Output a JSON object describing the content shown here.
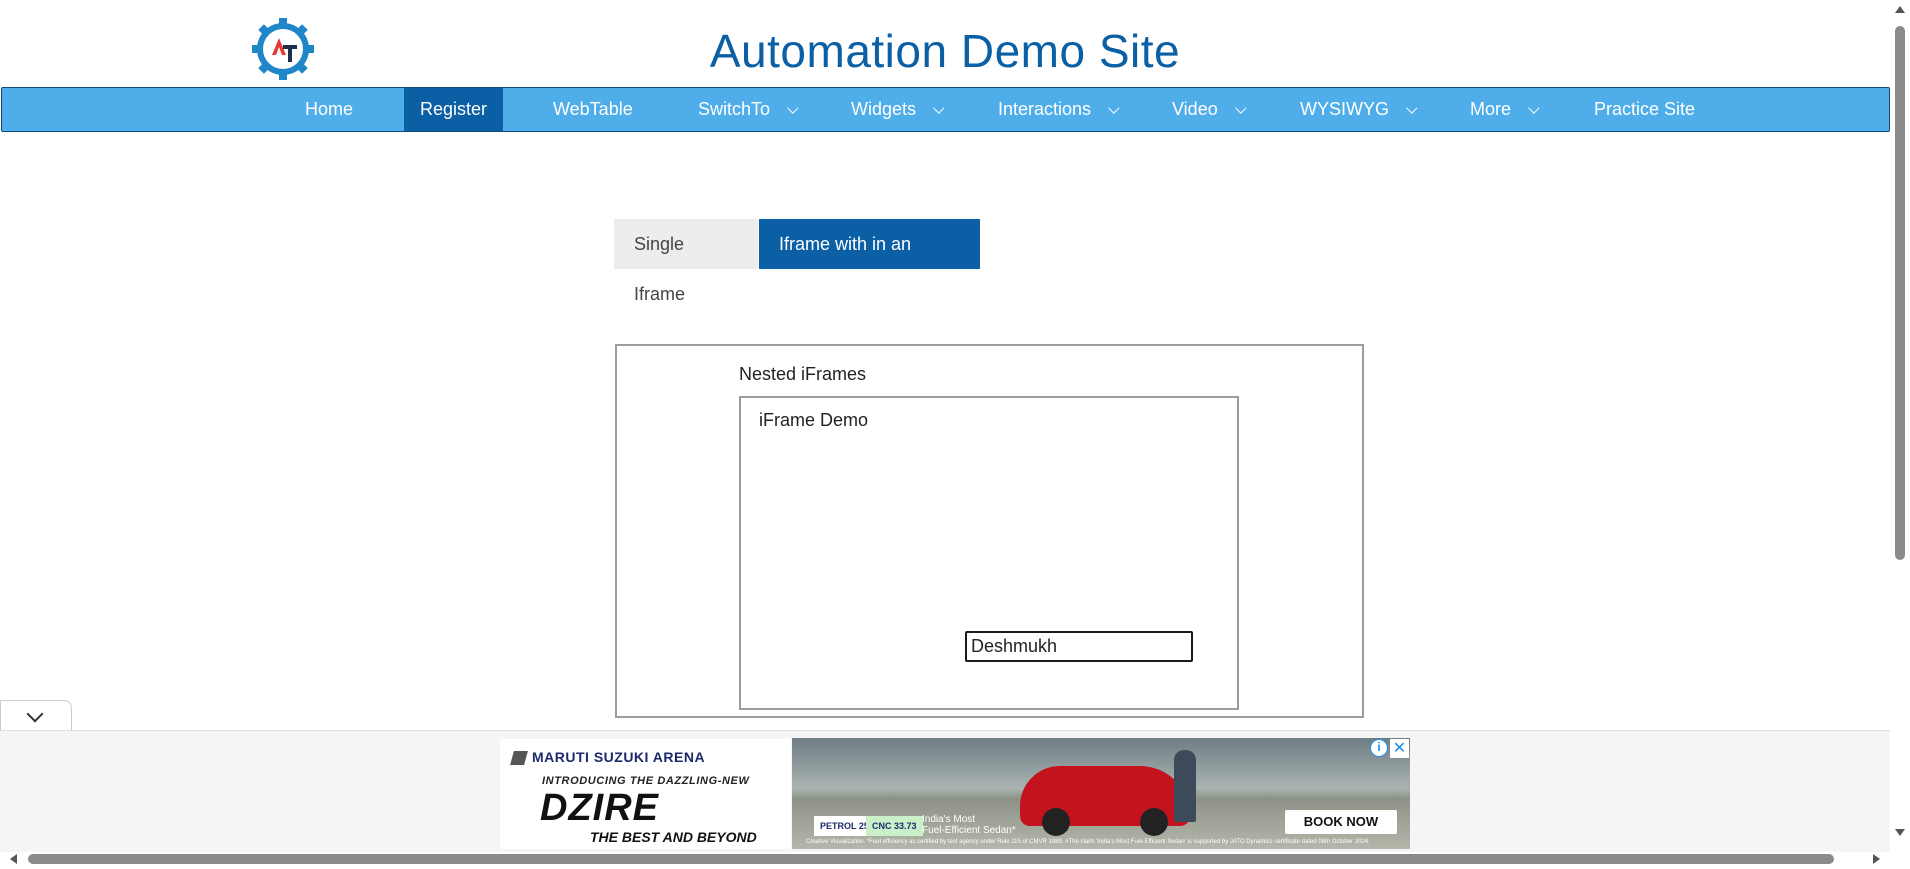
{
  "header": {
    "title": "Automation Demo Site",
    "logo_icon": "gear-logo-icon"
  },
  "nav": {
    "items": [
      {
        "label": "Home",
        "dropdown": false
      },
      {
        "label": "Register",
        "dropdown": false,
        "active": true
      },
      {
        "label": "WebTable",
        "dropdown": false
      },
      {
        "label": "SwitchTo",
        "dropdown": true
      },
      {
        "label": "Widgets",
        "dropdown": true
      },
      {
        "label": "Interactions",
        "dropdown": true
      },
      {
        "label": "Video",
        "dropdown": true
      },
      {
        "label": "WYSIWYG",
        "dropdown": true
      },
      {
        "label": "More",
        "dropdown": true
      },
      {
        "label": "Practice Site",
        "dropdown": false
      }
    ]
  },
  "tabs": {
    "single": "Single Iframe",
    "nested": "Iframe with in an Iframe"
  },
  "frames": {
    "outer_label": "Nested iFrames",
    "inner_label": "iFrame Demo",
    "input_value": "Deshmukh"
  },
  "ad": {
    "brand": "MARUTI SUZUKI ARENA",
    "intro": "INTRODUCING THE DAZZLING-NEW",
    "model": "DZIRE",
    "tagline": "THE BEST AND BEYOND",
    "petrol": "PETROL 25.71",
    "cnc": "CNC 33.73",
    "claim_line1": "India's Most",
    "claim_line2": "Fuel-Efficient Sedan*",
    "cta": "BOOK NOW",
    "disclaimer": "Creative Visualization. *Fuel efficiency as certified by test agency under Rule 115 of CMVR 1989. #The claim 'India's Most Fuel-Efficient Sedan' is supported by JATO Dynamics certificate dated 08th October 2024.",
    "info": "i",
    "close": "✕"
  },
  "colors": {
    "nav_bg": "#4fadea",
    "accent": "#0b5fa5"
  }
}
